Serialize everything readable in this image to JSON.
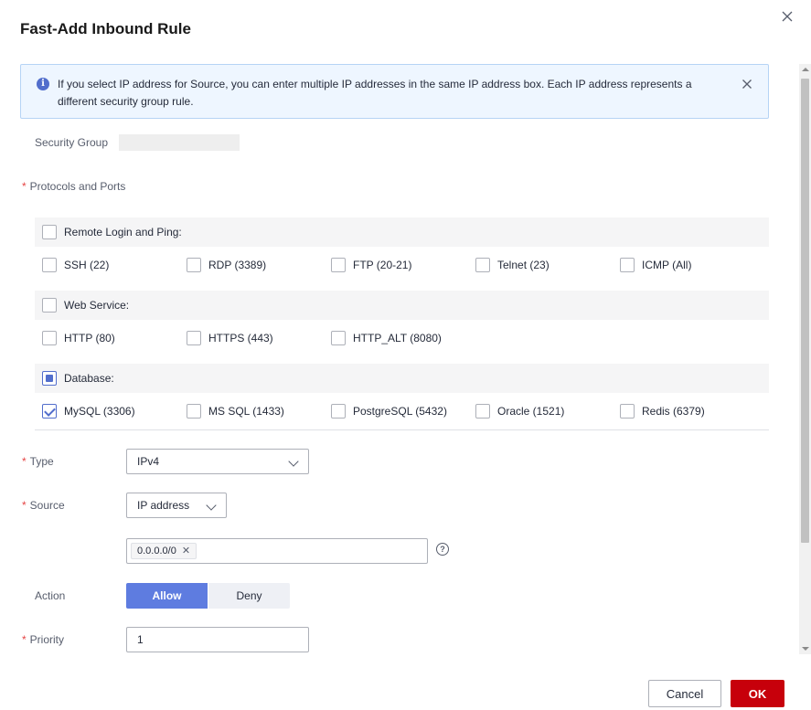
{
  "dialog": {
    "title": "Fast-Add Inbound Rule",
    "notice": "If you select IP address for Source, you can enter multiple IP addresses in the same IP address box. Each IP address represents a different security group rule."
  },
  "form": {
    "security_group_label": "Security Group",
    "protocols_label": "Protocols and Ports",
    "required_mark": "*",
    "groups": {
      "remote": {
        "label": "Remote Login and Ping:",
        "items": [
          "SSH (22)",
          "RDP (3389)",
          "FTP (20-21)",
          "Telnet (23)",
          "ICMP (All)"
        ]
      },
      "web": {
        "label": "Web Service:",
        "items": [
          "HTTP (80)",
          "HTTPS (443)",
          "HTTP_ALT (8080)"
        ]
      },
      "database": {
        "label": "Database:",
        "items": [
          "MySQL (3306)",
          "MS SQL (1433)",
          "PostgreSQL (5432)",
          "Oracle (1521)",
          "Redis (6379)"
        ],
        "checked": [
          "MySQL (3306)"
        ]
      }
    },
    "type_label": "Type",
    "type_value": "IPv4",
    "source_label": "Source",
    "source_value": "IP address",
    "source_tags": [
      "0.0.0.0/0"
    ],
    "action_label": "Action",
    "action_allow": "Allow",
    "action_deny": "Deny",
    "action_selected": "Allow",
    "priority_label": "Priority",
    "priority_value": "1"
  },
  "footer": {
    "cancel": "Cancel",
    "ok": "OK"
  },
  "colors": {
    "primary": "#5e7ce0",
    "ok_button": "#c7000b",
    "required": "#e54545",
    "notice_bg": "#eef6ff"
  }
}
